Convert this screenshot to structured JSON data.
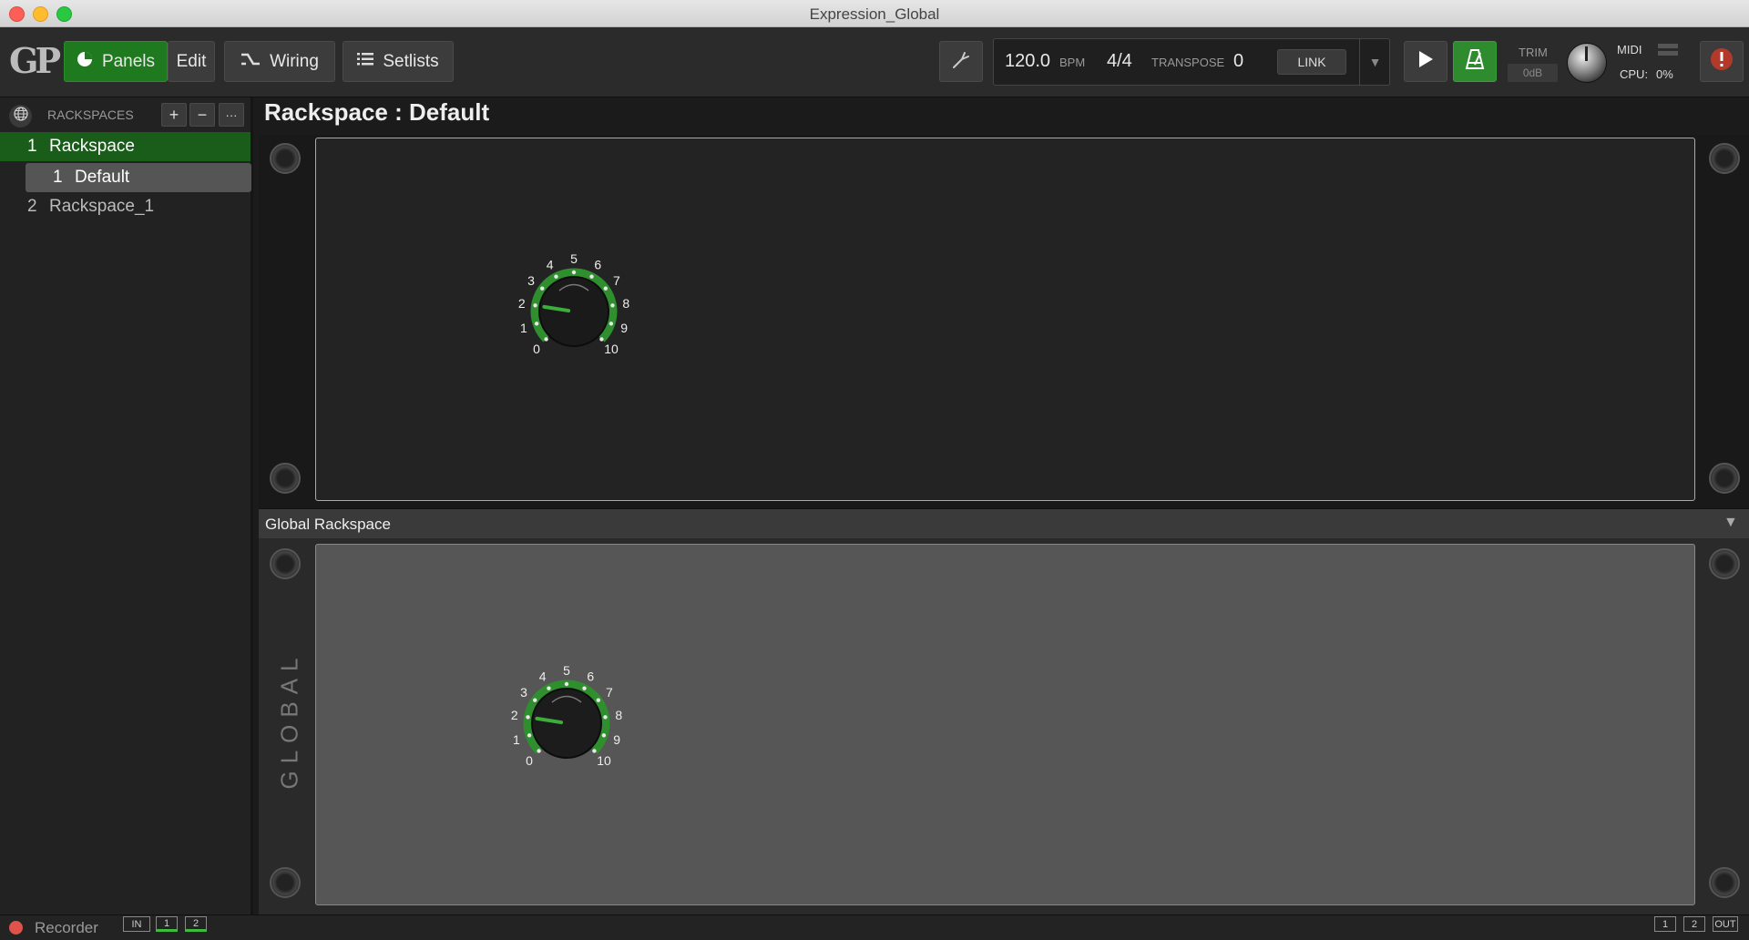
{
  "window": {
    "title": "Expression_Global"
  },
  "toolbar": {
    "logo": "GP",
    "panels_label": "Panels",
    "edit_label": "Edit",
    "wiring_label": "Wiring",
    "setlists_label": "Setlists",
    "tempo_value": "120.0",
    "tempo_unit": "BPM",
    "time_signature": "4/4",
    "transpose_label": "TRANSPOSE",
    "transpose_value": "0",
    "link_label": "LINK",
    "trim_label": "TRIM",
    "trim_value": "0dB",
    "midi_label": "MIDI",
    "cpu_label": "CPU:",
    "cpu_value": "0%",
    "accent_green": "#1f7a1f",
    "alert_color": "#b33a2a"
  },
  "sidebar": {
    "header": "RACKSPACES",
    "add_label": "+",
    "remove_label": "−",
    "more_label": "···",
    "items": [
      {
        "number": "1",
        "label": "Rackspace",
        "selected": true
      },
      {
        "number": "2",
        "label": "Rackspace_1",
        "selected": false
      }
    ],
    "variations": [
      {
        "number": "1",
        "label": "Default",
        "selected": true
      }
    ]
  },
  "main": {
    "title": "Rackspace : Default",
    "global_header": "Global Rackspace",
    "global_side_label": "GLOBAL"
  },
  "knob_scale": [
    "0",
    "1",
    "2",
    "3",
    "4",
    "5",
    "6",
    "7",
    "8",
    "9",
    "10"
  ],
  "knobs": {
    "rackspace_knob_value": 2,
    "global_knob_value": 2
  },
  "statusbar": {
    "recorder_label": "Recorder",
    "in_label": "IN",
    "in_ch1": "1",
    "in_ch2": "2",
    "out_ch1": "1",
    "out_ch2": "2",
    "out_label": "OUT"
  }
}
